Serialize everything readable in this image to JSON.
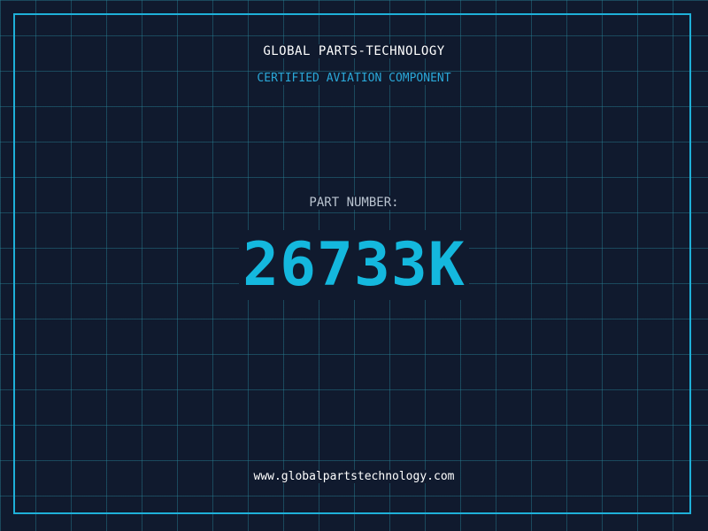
{
  "header": {
    "company": "GLOBAL PARTS-TECHNOLOGY",
    "tagline": "CERTIFIED AVIATION COMPONENT"
  },
  "part": {
    "label": "PART NUMBER:",
    "number": "26733K"
  },
  "footer": {
    "website": "www.globalpartstechnology.com"
  },
  "colors": {
    "background": "#101a2e",
    "grid": "#28828f",
    "accent": "#1fb0d8",
    "text": "#ffffff"
  }
}
